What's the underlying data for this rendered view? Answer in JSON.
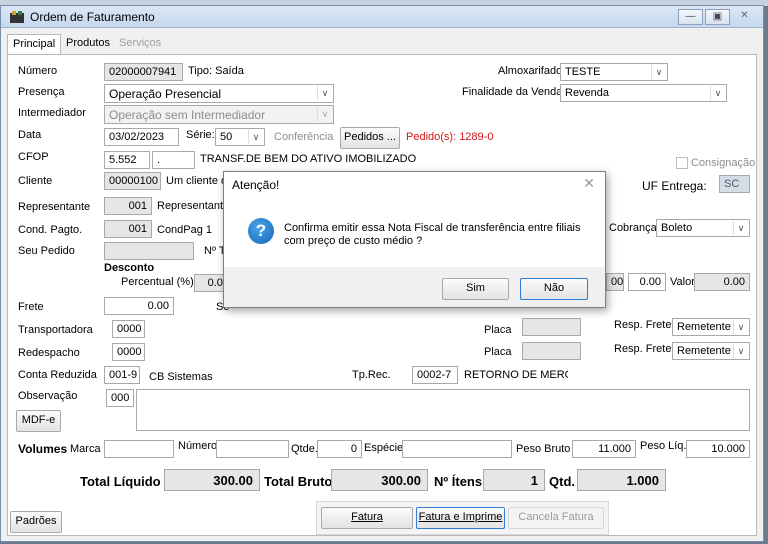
{
  "window": {
    "title": "Ordem de Faturamento"
  },
  "tabs": [
    {
      "label": "Principal",
      "state": "active"
    },
    {
      "label": "Produtos",
      "state": "normal"
    },
    {
      "label": "Serviços",
      "state": "disabled"
    }
  ],
  "form": {
    "numero_label": "Número",
    "numero_value": "02000007941",
    "tipo_text": "Tipo: Saída",
    "almox_label": "Almoxarifado",
    "almox_value": "TESTE",
    "presenca_label": "Presença",
    "presenca_value": "Operação Presencial",
    "finalidade_label": "Finalidade da Venda",
    "finalidade_value": "Revenda",
    "intermediador_label": "Intermediador",
    "intermediador_value": "Operação sem Intermediador",
    "data_label": "Data",
    "data_value": "03/02/2023",
    "serie_label": "Série:",
    "serie_value": "50",
    "conferencia_label": "Conferência",
    "pedidos_button": "Pedidos ...",
    "pedidos_text": "Pedido(s): 1289-0",
    "cfop_label": "CFOP",
    "cfop_value": "5.552",
    "cfop_extra": ".",
    "cfop_desc": "TRANSF.DE BEM DO ATIVO IMOBILIZADO",
    "consignacao_label": "Consignação",
    "cliente_label": "Cliente",
    "cliente_code": "00000100",
    "cliente_name": "Um cliente de",
    "uf_label": "UF Entrega:",
    "uf_value": "SC",
    "representante_label": "Representante",
    "representante_code": "001",
    "representante_name": "Representante",
    "cond_label": "Cond. Pagto.",
    "cond_code": "001",
    "cond_name": "CondPag 1",
    "cobranca_label": "Cobrança",
    "cobranca_value": "Boleto",
    "seu_pedido_label": "Seu Pedido",
    "nta_label": "Nº Ta",
    "desconto_label": "Desconto",
    "percentual_label": "Percentual (%)",
    "percentual_value": "0.00",
    "right_code": "00",
    "right_value": "0.00",
    "valor_label": "Valor",
    "valor_value": "0.00",
    "frete_label": "Frete",
    "frete_value": "0.00",
    "frete_s": "Se",
    "transportadora_label": "Transportadora",
    "transportadora_value": "0000",
    "placa_label": "Placa",
    "resp_frete_label": "Resp. Frete",
    "resp_frete_value": "Remetente",
    "redespacho_label": "Redespacho",
    "redespacho_value": "0000",
    "placa2_label": "Placa",
    "resp_frete2_label": "Resp. Frete",
    "resp_frete2_value": "Remetente",
    "conta_label": "Conta Reduzida",
    "conta_value": "001-9",
    "conta_name": "CB Sistemas",
    "tprec_label": "Tp.Rec.",
    "tprec_value": "0002-7",
    "tprec_name": "RETORNO DE MERCAD",
    "observacao_label": "Observação",
    "observacao_code": "000",
    "mdfe_button": "MDF-e",
    "volumes_label": "Volumes",
    "marca_label": "Marca",
    "numero_vol_label": "Número",
    "qtde_label": "Qtde.",
    "qtde_value": "0",
    "especie_label": "Espécie",
    "peso_bruto_label": "Peso Bruto",
    "peso_bruto_value": "11.000",
    "peso_liq_label": "Peso Líq.",
    "peso_liq_value": "10.000"
  },
  "totals": {
    "liquido_label": "Total Líquido",
    "liquido_value": "300.00",
    "bruto_label": "Total Bruto",
    "bruto_value": "300.00",
    "itens_label": "Nº Ítens",
    "itens_value": "1",
    "qtd_label": "Qtd.",
    "qtd_value": "1.000"
  },
  "buttons": {
    "padroes": "Padrões",
    "fatura": "Fatura",
    "fatura_imprime": "Fatura e Imprime",
    "cancela": "Cancela Fatura"
  },
  "dialog": {
    "title": "Atenção!",
    "message": "Confirma emitir essa Nota Fiscal de transferência entre filiais com preço de custo médio ?",
    "yes": "Sim",
    "no": "Não"
  },
  "colors": {
    "accent": "#2d7dd2",
    "warning_text": "#d01818",
    "readonly_bg": "#e6e6e6"
  }
}
